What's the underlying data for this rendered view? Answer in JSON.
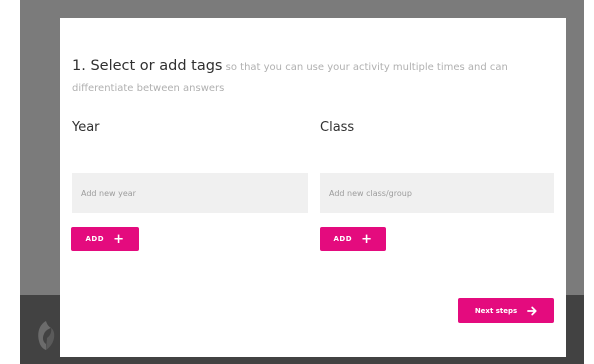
{
  "page": {
    "colors": {
      "accent": "#e40b7e",
      "backdrop": "#7b7b7b",
      "backdrop_bottom": "#424242",
      "input_background": "#f0f0f0",
      "heading_text": "#303030",
      "muted_text": "#b0b0b0"
    }
  },
  "modal": {
    "heading_strong": "1. Select or add tags",
    "heading_rest": " so that you can use your activity multiple times and can differentiate between answers",
    "year": {
      "label": "Year",
      "input_value": "",
      "placeholder": "Add new year",
      "add_label": "ADD",
      "add_icon": "plus-icon"
    },
    "class": {
      "label": "Class",
      "input_value": "",
      "placeholder": "Add new class/group",
      "add_label": "ADD",
      "add_icon": "plus-icon"
    },
    "next_button": {
      "label": "Next steps",
      "icon": "arrow-right-icon"
    }
  },
  "background": {
    "logo_icon": "brand-logo-icon"
  }
}
